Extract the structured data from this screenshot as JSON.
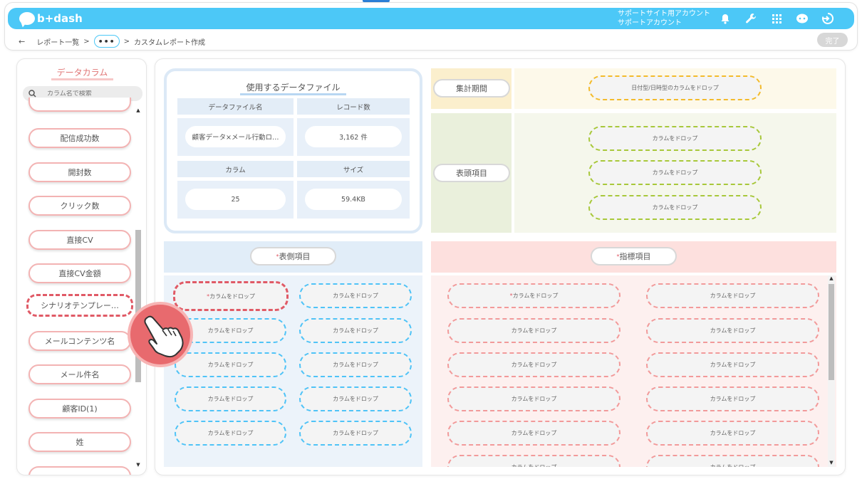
{
  "app": {
    "logo_text": "b+dash"
  },
  "header": {
    "account_line1": "サポートサイト用アカウント",
    "account_line2": "サポートアカウント",
    "icons": [
      "bell-icon",
      "wrench-icon",
      "grid-icon",
      "chat-bot-icon",
      "logout-icon"
    ]
  },
  "breadcrumb": {
    "back_icon": "←",
    "item1": "レポート一覧",
    "sep1": ">",
    "dots": "•••",
    "sep2": ">",
    "current": "カスタムレポート作成"
  },
  "done_label": "完了",
  "sidebar": {
    "title": "データカラム",
    "search_placeholder": "カラム名で検索",
    "items": [
      "配信成功数",
      "開封数",
      "クリック数",
      "直接CV",
      "直接CV金額",
      "シナリオテンプレー…",
      "メールコンテンツ名",
      "メール件名",
      "顧客ID(1)",
      "姓"
    ]
  },
  "datafile": {
    "title": "使用するデータファイル",
    "h_file": "データファイル名",
    "h_records": "レコード数",
    "v_file": "顧客データ×メール行動ロ…",
    "v_records": "3,162 件",
    "h_columns": "カラム",
    "h_size": "サイズ",
    "v_columns": "25",
    "v_size": "59.4KB"
  },
  "period": {
    "label": "集計期間",
    "drop": "日付型/日時型のカラムをドロップ"
  },
  "header_items": {
    "label": "表頭項目",
    "drop": "カラムをドロップ"
  },
  "side_items": {
    "label": "表側項目",
    "drop": "カラムをドロップ",
    "required": "*"
  },
  "metrics": {
    "label": "指標項目",
    "drop": "カラムをドロップ",
    "required": "*"
  },
  "colors": {
    "brand": "#4cc8f7",
    "accent_red": "#e05a66"
  }
}
